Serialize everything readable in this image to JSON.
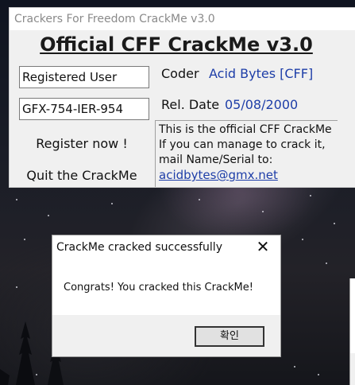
{
  "crackme_window": {
    "title": "Crackers For Freedom CrackMe v3.0",
    "heading": "Official CFF CrackMe v3.0",
    "name_value": "Registered User",
    "serial_value": "GFX-754-IER-954",
    "coder_label": "Coder",
    "coder_value": "Acid Bytes [CFF]",
    "reldate_label": "Rel. Date",
    "reldate_value": "05/08/2000",
    "register_label": "Register now !",
    "quit_label": "Quit the CrackMe",
    "info_lines": [
      "This is the official CFF CrackMe",
      "If you can manage to crack it,",
      "mail Name/Serial to:"
    ],
    "email": "acidbytes@gmx.net"
  },
  "message_box": {
    "title": "CrackMe cracked successfully",
    "close_glyph": "✕",
    "message": "Congrats! You cracked this CrackMe!",
    "ok_label": "확인"
  },
  "colors": {
    "link_blue": "#1e3ea8",
    "dialog_face": "#f0f0f0",
    "title_gray": "#8a8a8a"
  },
  "icons": [
    "close-icon"
  ]
}
